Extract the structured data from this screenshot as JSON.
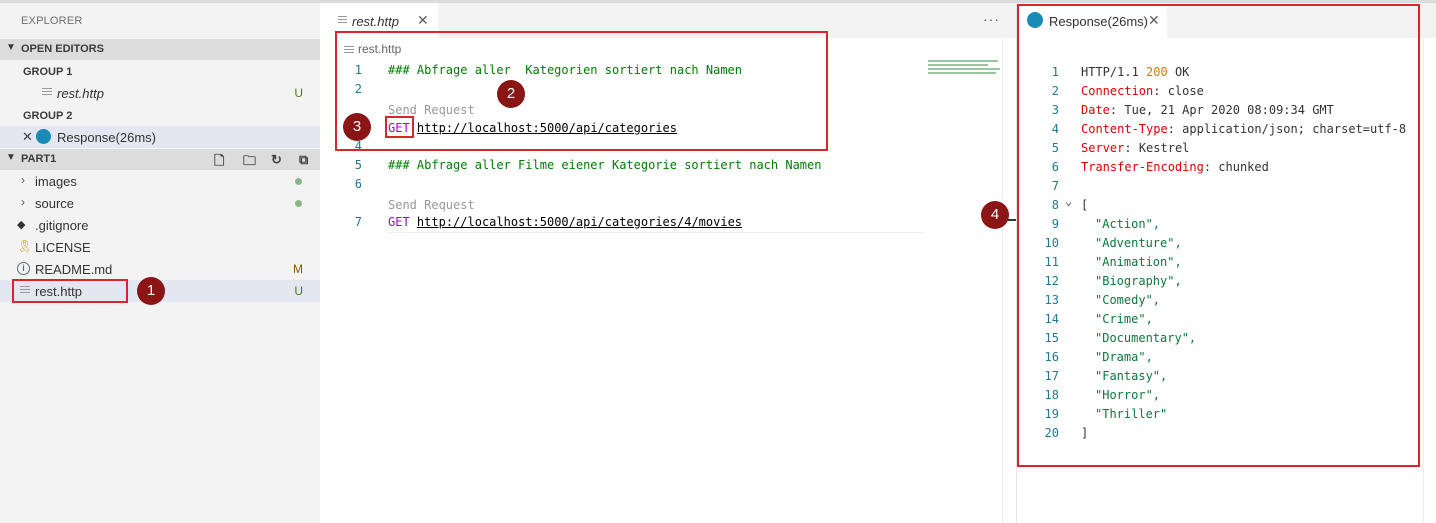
{
  "sidebar": {
    "title": "EXPLORER",
    "open_editors": {
      "label": "OPEN EDITORS",
      "group1": "GROUP 1",
      "group1_file": "rest.http",
      "group1_status": "U",
      "group2": "GROUP 2",
      "group2_file": "Response(26ms)"
    },
    "project": {
      "label": "PART1",
      "items": [
        {
          "label": "images",
          "status": "dot"
        },
        {
          "label": "source",
          "status": "dot"
        },
        {
          "label": ".gitignore",
          "status": ""
        },
        {
          "label": "LICENSE",
          "status": ""
        },
        {
          "label": "README.md",
          "status": "M"
        },
        {
          "label": "rest.http",
          "status": "U"
        }
      ]
    }
  },
  "editor": {
    "tab": "rest.http",
    "breadcrumb": "rest.http",
    "more": "···",
    "lines": {
      "l1_num": "1",
      "l1": "### Abfrage aller  Kategorien sortiert nach Namen",
      "l2_num": "2",
      "lens1": "Send Request",
      "l3_num": "3",
      "l3_method": "GET",
      "l3_url": "http://localhost:5000/api/categories",
      "l4_num": "4",
      "l5_num": "5",
      "l5": "### Abfrage aller Filme eiener Kategorie sortiert nach Namen",
      "l6_num": "6",
      "lens2": "Send Request",
      "l7_num": "7",
      "l7_method": "GET",
      "l7_url": "http://localhost:5000/api/categories/4/movies"
    }
  },
  "response": {
    "tab": "Response(26ms)",
    "status_line": {
      "proto": "HTTP/1.1 ",
      "code": "200",
      "text": " OK"
    },
    "headers": [
      {
        "name": "Connection",
        "value": " close"
      },
      {
        "name": "Date",
        "value": " Tue, 21 Apr 2020 08:09:34 GMT"
      },
      {
        "name": "Content-Type",
        "value": " application/json; charset=utf-8"
      },
      {
        "name": "Server",
        "value": " Kestrel"
      },
      {
        "name": "Transfer-Encoding",
        "value": " chunked"
      }
    ],
    "body_open": "[",
    "body_items": [
      "\"Action\",",
      "\"Adventure\",",
      "\"Animation\",",
      "\"Biography\",",
      "\"Comedy\",",
      "\"Crime\",",
      "\"Documentary\",",
      "\"Drama\",",
      "\"Fantasy\",",
      "\"Horror\",",
      "\"Thriller\""
    ],
    "body_close": "]",
    "line_numbers": [
      "1",
      "2",
      "3",
      "4",
      "5",
      "6",
      "7",
      "8",
      "9",
      "10",
      "11",
      "12",
      "13",
      "14",
      "15",
      "16",
      "17",
      "18",
      "19",
      "20"
    ]
  },
  "annotations": {
    "b1": "1",
    "b2": "2",
    "b3": "3",
    "b4": "4"
  },
  "colors": {
    "highlight": "#d8262c",
    "badge": "#8b1414",
    "comment": "#008000",
    "method": "#af00db"
  }
}
